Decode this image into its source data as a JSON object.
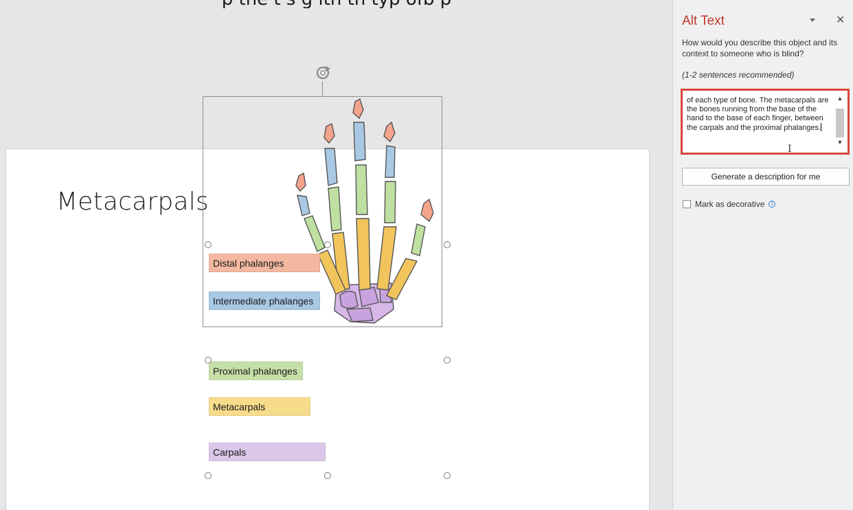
{
  "banner": {
    "text": "p  the t s g  ith th  typ  ofb   p"
  },
  "slide": {
    "title": "Metacarpals"
  },
  "labels": [
    {
      "text": "Distal phalanges",
      "color": "#f4b8a0"
    },
    {
      "text": "Intermediate phalanges",
      "color": "#a9c8e4"
    },
    {
      "text": "Proximal phalanges",
      "color": "#c6e0a8"
    },
    {
      "text": "Metacarpals",
      "color": "#f7dc8c"
    },
    {
      "text": "Carpals",
      "color": "#dcc7ea"
    }
  ],
  "alt_text_pane": {
    "title": "Alt Text",
    "question": "How would you describe this object and its context to someone who is blind?",
    "hint": "(1-2 sentences recommended)",
    "description": "of each type of bone. The metacarpals are the bones running from the base of the hand to the base of each finger, between the carpals and the proximal phalanges.",
    "generate_button": "Generate a description for me",
    "decorative_label": "Mark as decorative",
    "decorative_checked": false,
    "accent_color": "#c0392b",
    "highlight_color": "#d8473a"
  },
  "icons": {
    "close": "close-icon",
    "menu": "chevron-down-icon",
    "rotate": "rotate-icon",
    "info": "info-icon"
  }
}
